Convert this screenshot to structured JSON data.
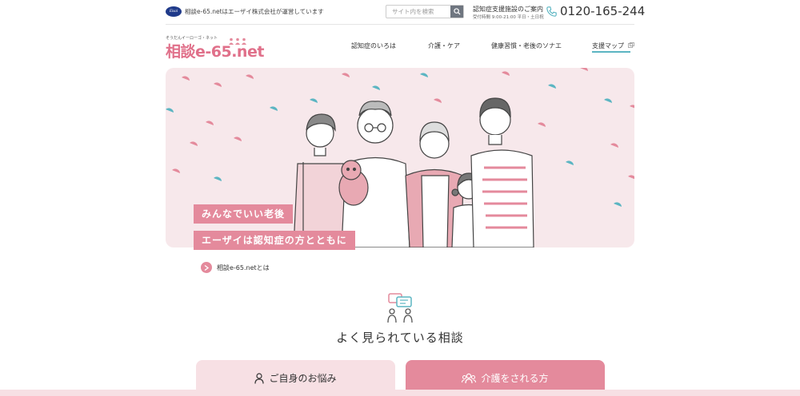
{
  "topbar": {
    "company_logo_text": "Eisai",
    "tagline": "相談e-65.netはエーザイ株式会社が運営しています",
    "search_placeholder": "サイト内を検索",
    "guide_title": "認知症支援施設のご案内",
    "guide_hours": "受付時間 9:00-21:00 平日・土日祝",
    "phone": "0120-165-244"
  },
  "header": {
    "logo_kana": "そうだんイーローゴ・ネット",
    "logo_text": "相談e-65.net"
  },
  "nav": {
    "items": [
      {
        "label": "認知症のいろは"
      },
      {
        "label": "介護・ケア"
      },
      {
        "label": "健康習慣・老後のソナエ"
      }
    ],
    "sitemap_label": "支援マップ"
  },
  "hero": {
    "catch_1": "みんなでいい老後",
    "catch_2": "エーザイは認知症の方とともに"
  },
  "about_link": {
    "label": "相談e-65.netとは"
  },
  "section": {
    "title": "よく見られている相談",
    "tabs": [
      {
        "label": "ご自身のお悩み",
        "icon": "person-icon"
      },
      {
        "label": "介護をされる方",
        "icon": "group-icon"
      }
    ]
  },
  "colors": {
    "accent_pink": "#e48a9c",
    "light_pink": "#f7e0e4",
    "teal": "#5bb5c2",
    "hero_bg": "#f7e8eb"
  }
}
